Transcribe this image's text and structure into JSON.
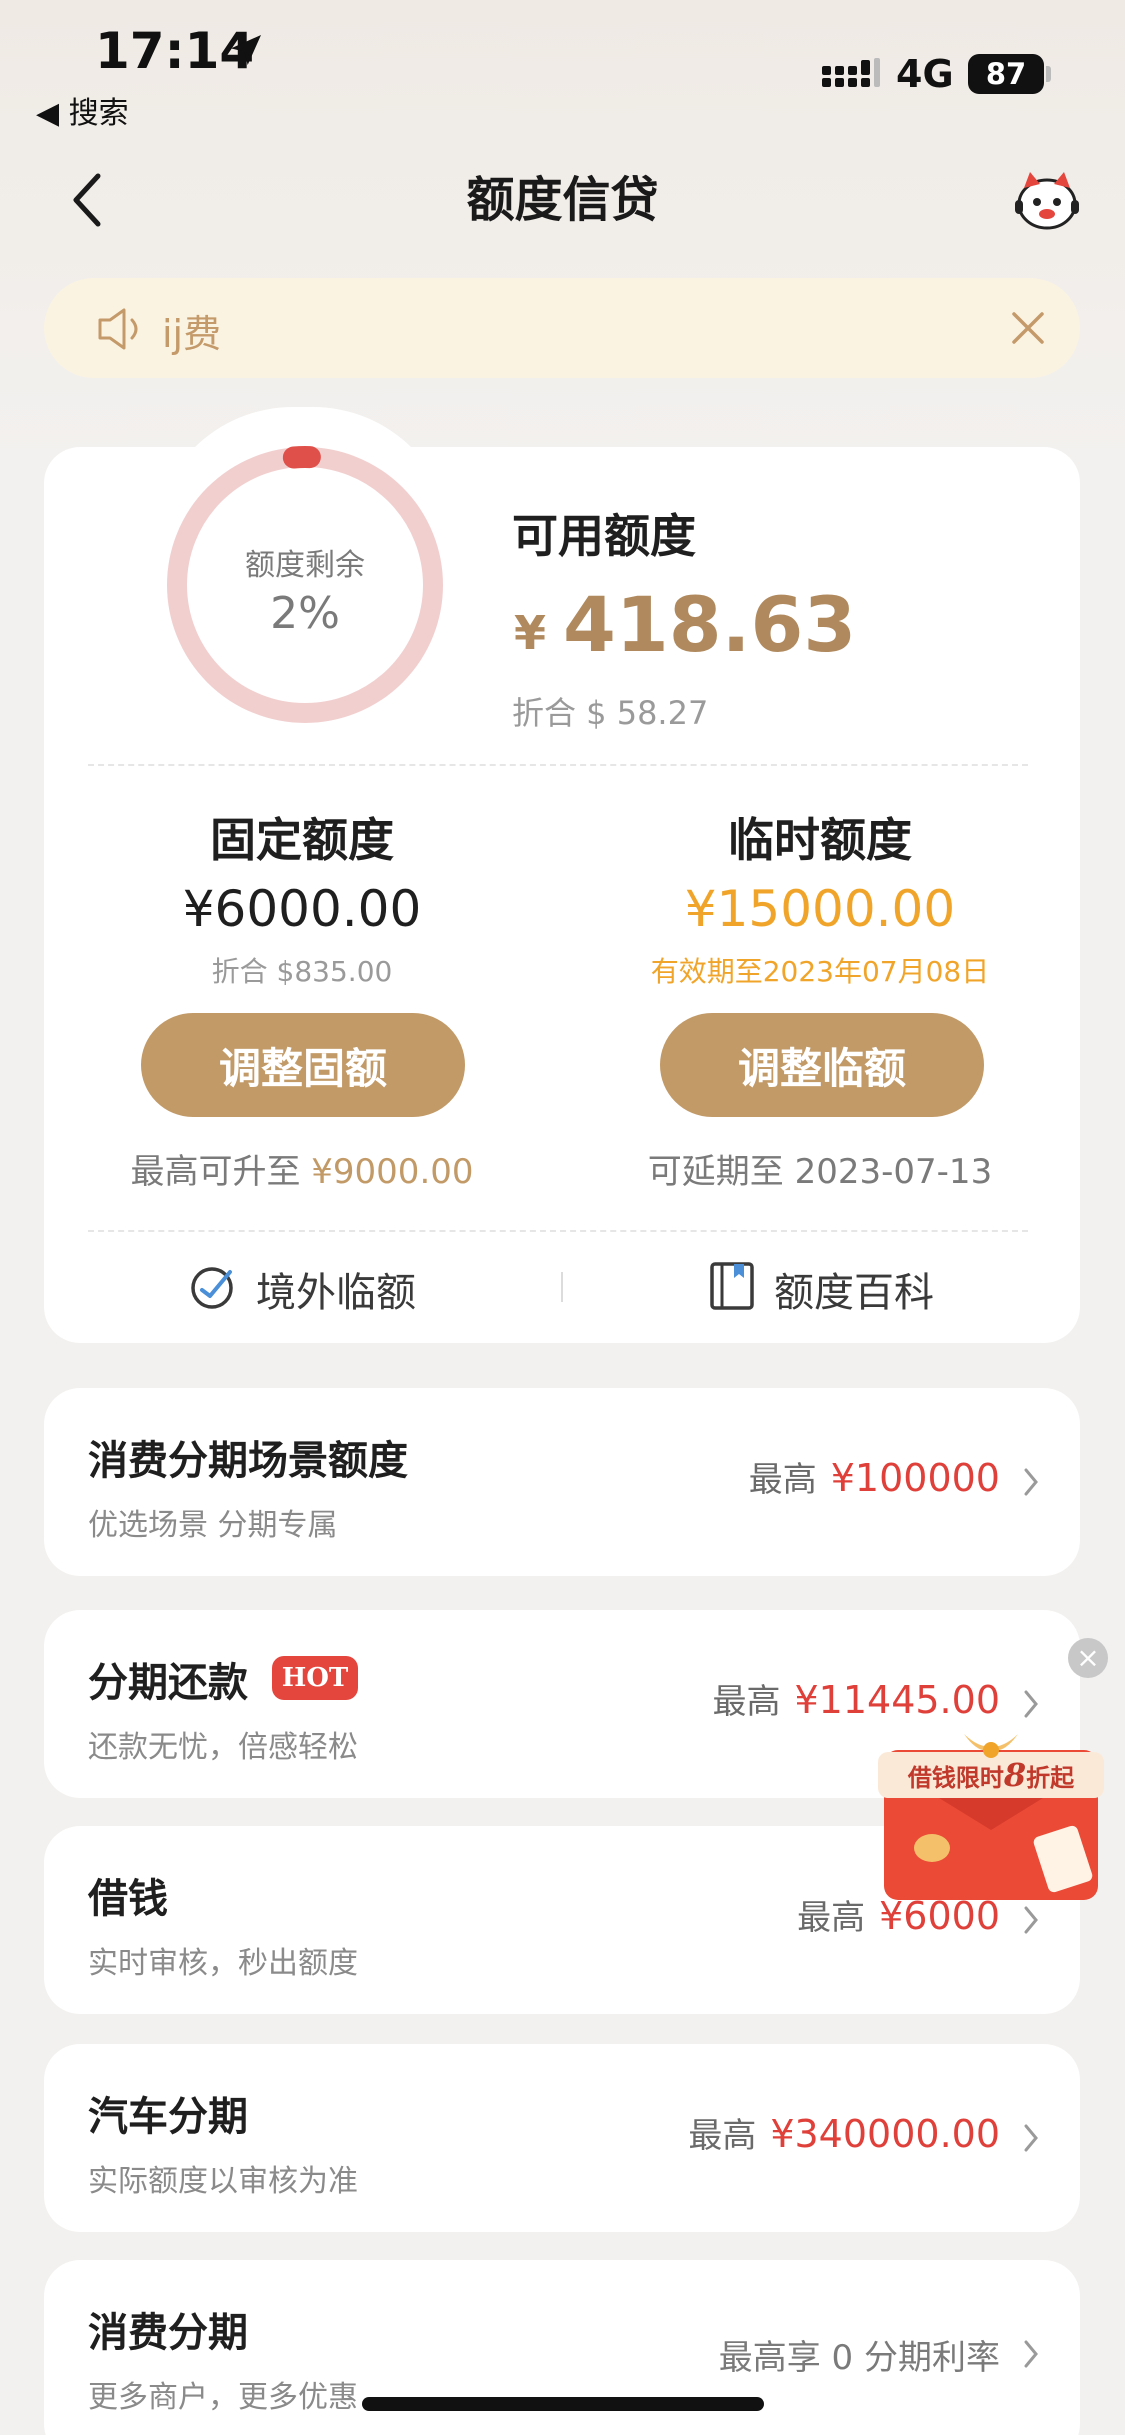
{
  "status_bar": {
    "time": "17:14",
    "back_app": "◀ 搜索",
    "network": "4G",
    "battery": "87"
  },
  "nav": {
    "title": "额度信贷",
    "back_icon": "chevron-left-icon",
    "avatar_icon": "mascot-avatar-icon"
  },
  "notice": {
    "text": "ij费",
    "icon": "speaker-icon"
  },
  "credit": {
    "ring_label": "额度剩余",
    "ring_value": "2%",
    "remaining_fraction": 0.02,
    "available_title": "可用额度",
    "currency_symbol": "¥",
    "available_amount": "418.63",
    "available_usd": "折合 $ 58.27",
    "fixed": {
      "title": "固定额度",
      "amount": "¥6000.00",
      "usd": "折合 $835.00",
      "button": "调整固额",
      "note_prefix": "最高可升至 ",
      "note_amount": "¥9000.00"
    },
    "temporary": {
      "title": "临时额度",
      "amount": "¥15000.00",
      "validity": "有效期至2023年07月08日",
      "button": "调整临额",
      "note": "可延期至 2023-07-13"
    },
    "links": {
      "overseas": "境外临额",
      "encyclopedia": "额度百科"
    }
  },
  "list": [
    {
      "title": "消费分期场景额度",
      "subtitle": "优选场景 分期专属",
      "prefix": "最高",
      "amount": "¥100000"
    },
    {
      "title": "分期还款",
      "badge": "HOT",
      "subtitle": "还款无忧，倍感轻松",
      "prefix": "最高",
      "amount": "¥11445.00"
    },
    {
      "title": "借钱",
      "subtitle": "实时审核，秒出额度",
      "prefix": "最高",
      "amount": "¥6000"
    },
    {
      "title": "汽车分期",
      "subtitle": "实际额度以审核为准",
      "prefix": "最高",
      "amount": "¥340000.00"
    },
    {
      "title": "消费分期",
      "subtitle": "更多商户，更多优惠",
      "note": "最高享 0 分期利率"
    }
  ],
  "promo": {
    "text_a": "借钱限时",
    "text_b": "8",
    "text_c": "折起"
  },
  "colors": {
    "gold": "#c29a68",
    "gold_text": "#b08a5e",
    "orange": "#f0a52a",
    "red": "#e0403a",
    "notice_bg": "#fbf3e1"
  }
}
